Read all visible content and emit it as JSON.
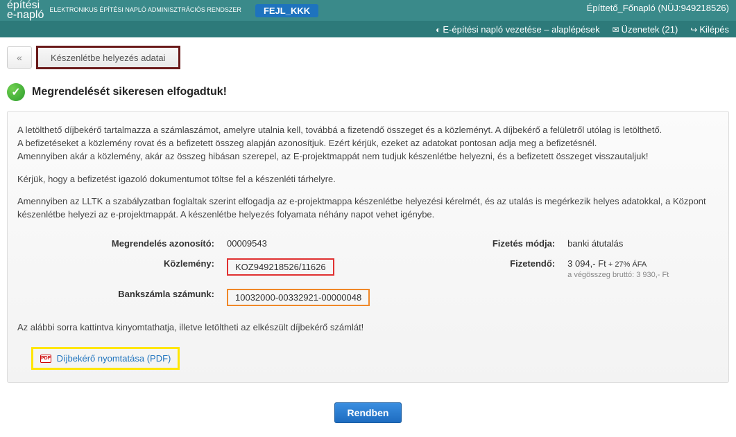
{
  "header": {
    "logo_top": "építési",
    "logo_bottom": "e-napló",
    "logo_desc": "ELEKTRONIKUS ÉPÍTÉSI NAPLÓ ADMINISZTRÁCIÓS RENDSZER",
    "badge": "FEJL_KKK",
    "user": "Építtető_Főnapló (NÜJ:949218526)"
  },
  "subheader": {
    "help": "E-építési napló vezetése – alaplépések",
    "messages": "Üzenetek (21)",
    "logout": "Kilépés"
  },
  "breadcrumb": {
    "back": "«",
    "current": "Készenlétbe helyezés adatai"
  },
  "success": {
    "title": "Megrendelését sikeresen elfogadtuk!"
  },
  "body": {
    "p1": "A letölthető díjbekérő tartalmazza a számlaszámot, amelyre utalnia kell, továbbá a fizetendő összeget és a közleményt. A díjbekérő a felületről utólag is letölthető.",
    "p2": "A befizetéseket a közlemény rovat és a befizetett összeg alapján azonosítjuk. Ezért kérjük, ezeket az adatokat pontosan adja meg a befizetésnél.",
    "p3": "Amennyiben akár a közlemény, akár az összeg hibásan szerepel, az E-projektmappát nem tudjuk készenlétbe helyezni, és a befizetett összeget visszautaljuk!",
    "p4": "Kérjük, hogy a befizetést igazoló dokumentumot töltse fel a készenléti tárhelyre.",
    "p5": "Amennyiben az LLTK a szabályzatban foglaltak szerint elfogadja az e-projektmappa készenlétbe helyezési kérelmét, és az utalás is megérkezik helyes adatokkal, a Központ készenlétbe helyezi az e-projektmappát. A készenlétbe helyezés folyamata néhány napot vehet igénybe."
  },
  "order": {
    "lbl_id": "Megrendelés azonosító:",
    "val_id": "00009543",
    "lbl_paymode": "Fizetés módja:",
    "val_paymode": "banki átutalás",
    "lbl_ref": "Közlemény:",
    "val_ref": "KOZ949218526/11626",
    "lbl_due": "Fizetendő:",
    "val_due": "3 094,- Ft",
    "val_due_suffix": " + 27% ÁFA",
    "val_gross": "a végösszeg bruttó: 3 930,- Ft",
    "lbl_account": "Bankszámla számunk:",
    "val_account": "10032000-00332921-00000048"
  },
  "print": {
    "intro": "Az alábbi sorra kattintva kinyomtathatja, illetve letöltheti az elkészült díjbekérő számlát!",
    "link": "Díjbekérő nyomtatása (PDF)",
    "icon_label": "PDF"
  },
  "buttons": {
    "ok": "Rendben"
  }
}
